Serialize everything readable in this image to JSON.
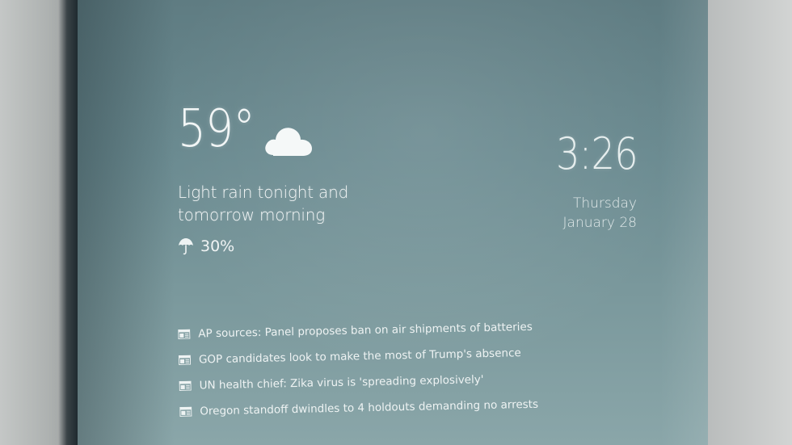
{
  "weather": {
    "temperature": "59°",
    "condition_icon": "cloud-icon",
    "summary_line1": "Light rain tonight and",
    "summary_line2": "tomorrow morning",
    "precip_icon": "umbrella-icon",
    "precip_chance": "30%"
  },
  "clock": {
    "time": "3:26",
    "weekday": "Thursday",
    "date": "January 28"
  },
  "news": {
    "icon": "newspaper-icon",
    "headlines": [
      "AP sources: Panel proposes ban on air shipments of batteries",
      "GOP candidates look to make the most of Trump's absence",
      "UN health chief: Zika virus is 'spreading explosively'",
      "Oregon standoff dwindles to 4 holdouts demanding no arrests"
    ]
  },
  "colors": {
    "screen_top": "#5f7c82",
    "screen_bottom": "#8aa6a9",
    "text": "#f2f6f6"
  }
}
